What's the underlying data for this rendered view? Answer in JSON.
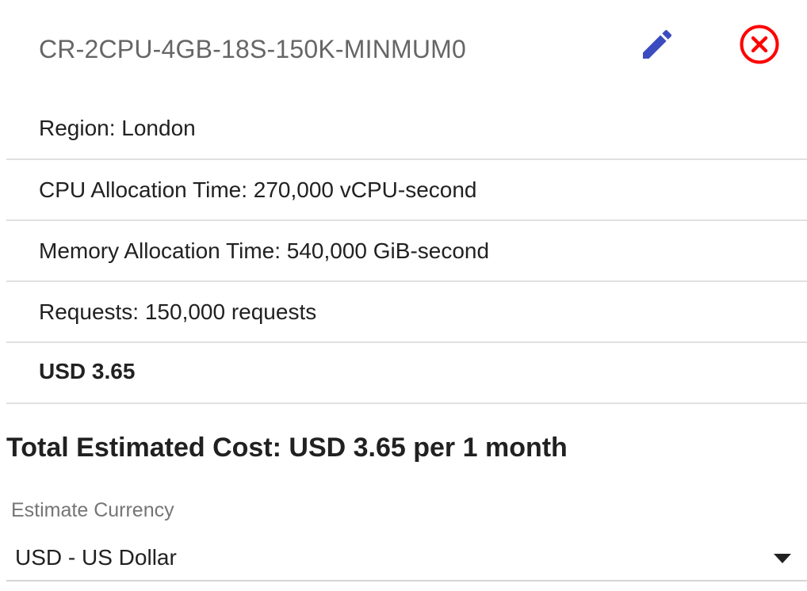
{
  "estimate_item": {
    "title": "CR-2CPU-4GB-18S-150K-MINMUM0",
    "edit_icon": "pencil-icon",
    "remove_icon": "close-circle-icon",
    "details": [
      {
        "label": "Region: London"
      },
      {
        "label": "CPU Allocation Time: 270,000 vCPU-second"
      },
      {
        "label": "Memory Allocation Time: 540,000 GiB-second"
      },
      {
        "label": "Requests: 150,000 requests"
      }
    ],
    "cost": "USD 3.65"
  },
  "total": {
    "text": "Total Estimated Cost: USD 3.65 per 1 month"
  },
  "currency": {
    "label": "Estimate Currency",
    "selected": "USD - US Dollar",
    "dropdown_icon": "triangle-down-icon"
  },
  "colors": {
    "edit_icon": "#3b4cc0",
    "remove_icon": "#ff0000",
    "divider": "#e0e0e0",
    "title_text": "#666666",
    "muted_text": "#757575"
  }
}
